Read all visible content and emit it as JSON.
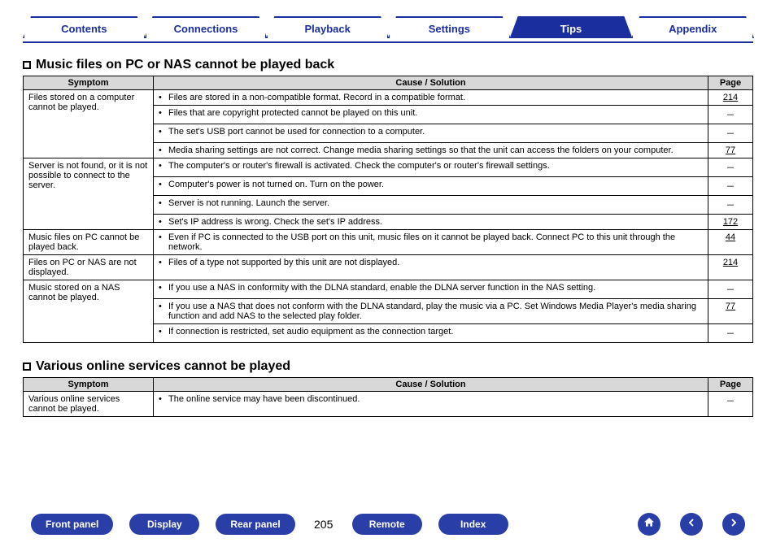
{
  "tabs": {
    "contents": "Contents",
    "connections": "Connections",
    "playback": "Playback",
    "settings": "Settings",
    "tips": "Tips",
    "appendix": "Appendix",
    "active": "tips"
  },
  "sections": [
    {
      "title": "Music files on PC or NAS cannot be played back",
      "headers": {
        "symptom": "Symptom",
        "cause": "Cause / Solution",
        "page": "Page"
      },
      "groups": [
        {
          "symptom": "Files stored on a computer cannot be played.",
          "rows": [
            {
              "text": "Files are stored in a non-compatible format. Record in a compatible format.",
              "page": "214",
              "link": true
            },
            {
              "text": "Files that are copyright protected cannot be played on this unit.",
              "page": "－"
            },
            {
              "text": "The set's USB port cannot be used for connection to a computer.",
              "page": "－"
            },
            {
              "text": "Media sharing settings are not correct. Change media sharing settings so that the unit can access the folders on your computer.",
              "page": "77",
              "link": true
            }
          ]
        },
        {
          "symptom": "Server is not found, or it is not possible to connect to the server.",
          "rows": [
            {
              "text": "The computer's or router's firewall is activated. Check the computer's or router's firewall settings.",
              "page": "－"
            },
            {
              "text": "Computer's power is not turned on. Turn on the power.",
              "page": "－"
            },
            {
              "text": "Server is not running. Launch the server.",
              "page": "－"
            },
            {
              "text": "Set's IP address is wrong. Check the set's IP address.",
              "page": "172",
              "link": true
            }
          ]
        },
        {
          "symptom": "Music files on PC cannot be played back.",
          "rows": [
            {
              "text": "Even if PC is connected to the USB port on this unit, music files on it cannot be played back. Connect PC to this unit through the network.",
              "page": "44",
              "link": true
            }
          ]
        },
        {
          "symptom": "Files on PC or NAS are not displayed.",
          "rows": [
            {
              "text": "Files of a type not supported by this unit are not displayed.",
              "page": "214",
              "link": true
            }
          ]
        },
        {
          "symptom": "Music stored on a NAS cannot be played.",
          "rows": [
            {
              "text": "If you use a NAS in conformity with the DLNA standard, enable the DLNA server function in the NAS setting.",
              "page": "－"
            },
            {
              "text": "If you use a NAS that does not conform with the DLNA standard, play the music via a PC. Set Windows Media Player's media sharing function and add NAS to the selected play folder.",
              "page": "77",
              "link": true
            },
            {
              "text": "If connection is restricted, set audio equipment as the connection target.",
              "page": "－"
            }
          ]
        }
      ]
    },
    {
      "title": "Various online services cannot be played",
      "headers": {
        "symptom": "Symptom",
        "cause": "Cause / Solution",
        "page": "Page"
      },
      "groups": [
        {
          "symptom": "Various online services cannot be played.",
          "rows": [
            {
              "text": "The online service may have been discontinued.",
              "page": "－"
            }
          ]
        }
      ]
    }
  ],
  "footer": {
    "front_panel": "Front panel",
    "display": "Display",
    "rear_panel": "Rear panel",
    "remote": "Remote",
    "index": "Index",
    "page_number": "205"
  }
}
